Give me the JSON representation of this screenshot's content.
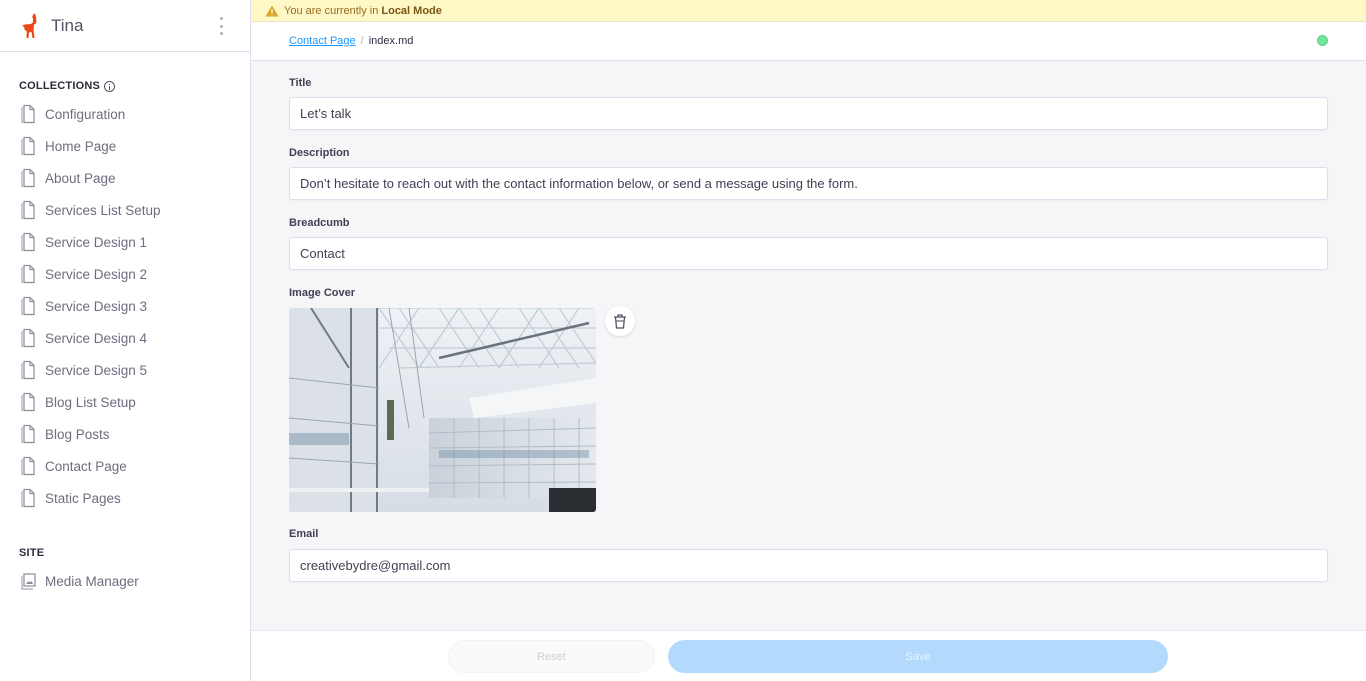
{
  "app": {
    "title": "Tina"
  },
  "banner": {
    "prefix": "You are currently in",
    "mode": "Local Mode"
  },
  "breadcrumb": {
    "parent": "Contact Page",
    "separator": "/",
    "current": "index.md"
  },
  "status": {
    "color": "#76e39b"
  },
  "sidebar": {
    "collections_label": "COLLECTIONS",
    "collections": [
      {
        "label": "Configuration",
        "icon": "document-icon"
      },
      {
        "label": "Home Page",
        "icon": "document-icon"
      },
      {
        "label": "About Page",
        "icon": "document-icon"
      },
      {
        "label": "Services List Setup",
        "icon": "document-icon"
      },
      {
        "label": "Service Design 1",
        "icon": "document-icon"
      },
      {
        "label": "Service Design 2",
        "icon": "document-icon"
      },
      {
        "label": "Service Design 3",
        "icon": "document-icon"
      },
      {
        "label": "Service Design 4",
        "icon": "document-icon"
      },
      {
        "label": "Service Design 5",
        "icon": "document-icon"
      },
      {
        "label": "Blog List Setup",
        "icon": "document-icon"
      },
      {
        "label": "Blog Posts",
        "icon": "document-icon"
      },
      {
        "label": "Contact Page",
        "icon": "document-icon"
      },
      {
        "label": "Static Pages",
        "icon": "document-icon"
      }
    ],
    "site_label": "SITE",
    "site": [
      {
        "label": "Media Manager",
        "icon": "media-icon"
      }
    ]
  },
  "form": {
    "title": {
      "label": "Title",
      "value": "Let’s talk"
    },
    "description": {
      "label": "Description",
      "value": "Don’t hesitate to reach out with the contact information below, or send a message using the form."
    },
    "breadcrumb": {
      "label": "Breadcumb",
      "value": "Contact"
    },
    "image_cover": {
      "label": "Image Cover",
      "alt": "Modern white atrium interior with glass walls and triangular skylight"
    },
    "email": {
      "label": "Email",
      "value": "creativebydre@gmail.com"
    }
  },
  "footer": {
    "reset_label": "Reset",
    "save_label": "Save"
  },
  "colors": {
    "brand": "#ec4815",
    "link": "#2296fe",
    "save_disabled": "#b3d9fd",
    "banner_bg": "#fef7c6"
  }
}
